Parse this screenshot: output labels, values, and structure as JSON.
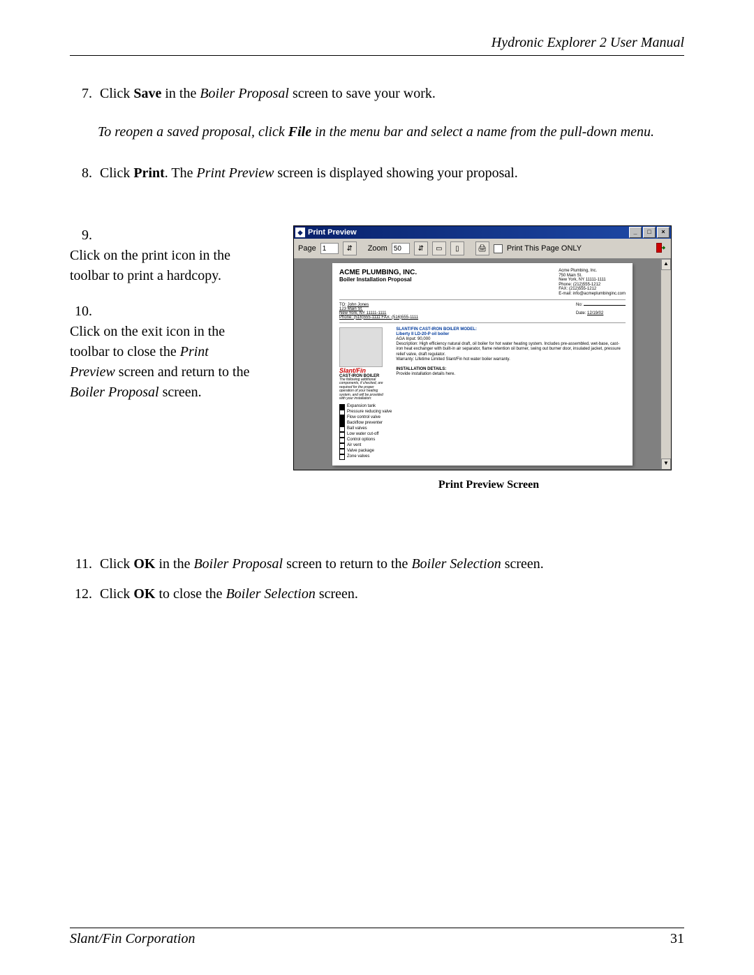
{
  "header": {
    "title": "Hydronic Explorer 2 User Manual"
  },
  "steps": {
    "s7": {
      "num": "7.",
      "text_before": "Click ",
      "bold": "Save",
      "text_mid": " in the ",
      "ital": "Boiler Proposal",
      "text_after": " screen to save your work."
    },
    "s7_note": {
      "pre": "To reopen a saved proposal, click ",
      "bold": "File",
      "post": " in the menu bar and select a name from the pull-down menu."
    },
    "s8": {
      "num": "8.",
      "text_before": "Click ",
      "bold": "Print",
      "text_mid": ". The ",
      "ital": "Print Preview",
      "text_after": " screen is displayed showing your proposal."
    },
    "s9": {
      "num": "9.",
      "text": "Click on the print icon in the toolbar to print a hardcopy."
    },
    "s10": {
      "num": "10.",
      "pre": "Click on the exit icon in the toolbar to close the ",
      "ital1": "Print Preview",
      "mid": " screen and return to the ",
      "ital2": "Boiler Proposal",
      "post": " screen."
    },
    "s11": {
      "num": "11.",
      "pre": "Click ",
      "bold": "OK",
      "mid": " in the ",
      "ital1": "Boiler Proposal",
      "mid2": " screen to return to the ",
      "ital2": "Boiler Selection",
      "post": " screen."
    },
    "s12": {
      "num": "12.",
      "pre": "Click ",
      "bold": "OK",
      "mid": " to close the ",
      "ital": "Boiler Selection",
      "post": " screen."
    }
  },
  "window": {
    "title": "Print Preview",
    "toolbar": {
      "page_label": "Page",
      "page_value": "1",
      "zoom_label": "Zoom",
      "zoom_value": "50",
      "print_this_page": "Print This Page ONLY"
    }
  },
  "sheet": {
    "company": "ACME PLUMBING, INC.",
    "subtitle": "Boiler Installation Proposal",
    "addr": "Acme Plumbing, Inc.\n750 Main St.\nNew York, NY 11111-1111\nPhone: (212)555-1212\nFAX: (212)555-1212\nE-mail: info@acmeplumbinginc.com",
    "to_label": "TO:",
    "to_name": "John Jones",
    "to_addr1": "123 Main St.",
    "to_addr2": "New York, NY 11111-1111",
    "to_phone": "Phone: (516)555-1111   FAX: (516)555-1111",
    "no_label": "No:",
    "date_label": "Date:",
    "date_value": "12/19/02",
    "brand": "Slant/Fin",
    "cast": "CAST-IRON BOILER",
    "comp_note": "The following additional components, if checked, are required for the proper operation of your heating system, and will be provided with your installation:",
    "model_head1": "SLANT/FIN CAST-IRON BOILER MODEL:",
    "model_head2": "Liberty II LD-20-P oil boiler",
    "spec1": "AGA Input: 90,000",
    "spec2": "Description: High efficiency natural draft, oil boiler for hot water heating system. Includes pre-assembled, wet-base, cast-iron heat exchanger with built-in air separator, flame retention oil burner, swing out burner door, insulated jacket, pressure relief valve, draft regulator.",
    "spec3": "Warranty: Lifetime Limited Slant/Fin hot water boiler warranty.",
    "install_head": "INSTALLATION DETAILS:",
    "install_body": "Provide installation details here.",
    "options": [
      {
        "checked": true,
        "label": "Expansion tank"
      },
      {
        "checked": false,
        "label": "Pressure reducing valve"
      },
      {
        "checked": true,
        "label": "Flow control valve"
      },
      {
        "checked": true,
        "label": "Backflow preventer"
      },
      {
        "checked": false,
        "label": "Ball valves"
      },
      {
        "checked": false,
        "label": "Low water cut-off"
      },
      {
        "checked": false,
        "label": "Control options"
      },
      {
        "checked": false,
        "label": "Air vent"
      },
      {
        "checked": false,
        "label": "Valve package"
      },
      {
        "checked": false,
        "label": "Zone valves"
      }
    ]
  },
  "caption": "Print Preview Screen",
  "footer": {
    "corp": "Slant/Fin Corporation",
    "page": "31"
  }
}
